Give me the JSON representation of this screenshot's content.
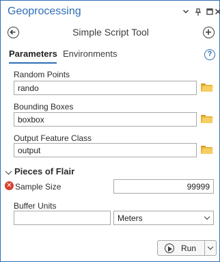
{
  "window": {
    "title": "Geoprocessing",
    "controls": [
      "chevron-down-icon",
      "pin-icon",
      "maximize-icon",
      "close-icon"
    ]
  },
  "header": {
    "title": "Simple Script Tool",
    "back_icon": "back-arrow-icon",
    "add_icon": "add-icon"
  },
  "tabs": [
    {
      "label": "Parameters",
      "active": true
    },
    {
      "label": "Environments",
      "active": false
    }
  ],
  "help_icon": "?",
  "params": {
    "random_points": {
      "label": "Random Points",
      "value": "rando"
    },
    "bounding_boxes": {
      "label": "Bounding Boxes",
      "value": "boxbox"
    },
    "output_feature_class": {
      "label": "Output Feature Class",
      "value": "output"
    }
  },
  "group": {
    "label": "Pieces of Flair",
    "sample_size": {
      "label": "Sample Size",
      "value": "99999",
      "status": "error"
    },
    "buffer_units": {
      "label": "Buffer Units",
      "value": "",
      "unit": "Meters"
    }
  },
  "run": {
    "label": "Run"
  },
  "colors": {
    "accent": "#2e6db4",
    "error": "#d6402f",
    "folder": "#f6cf63"
  }
}
